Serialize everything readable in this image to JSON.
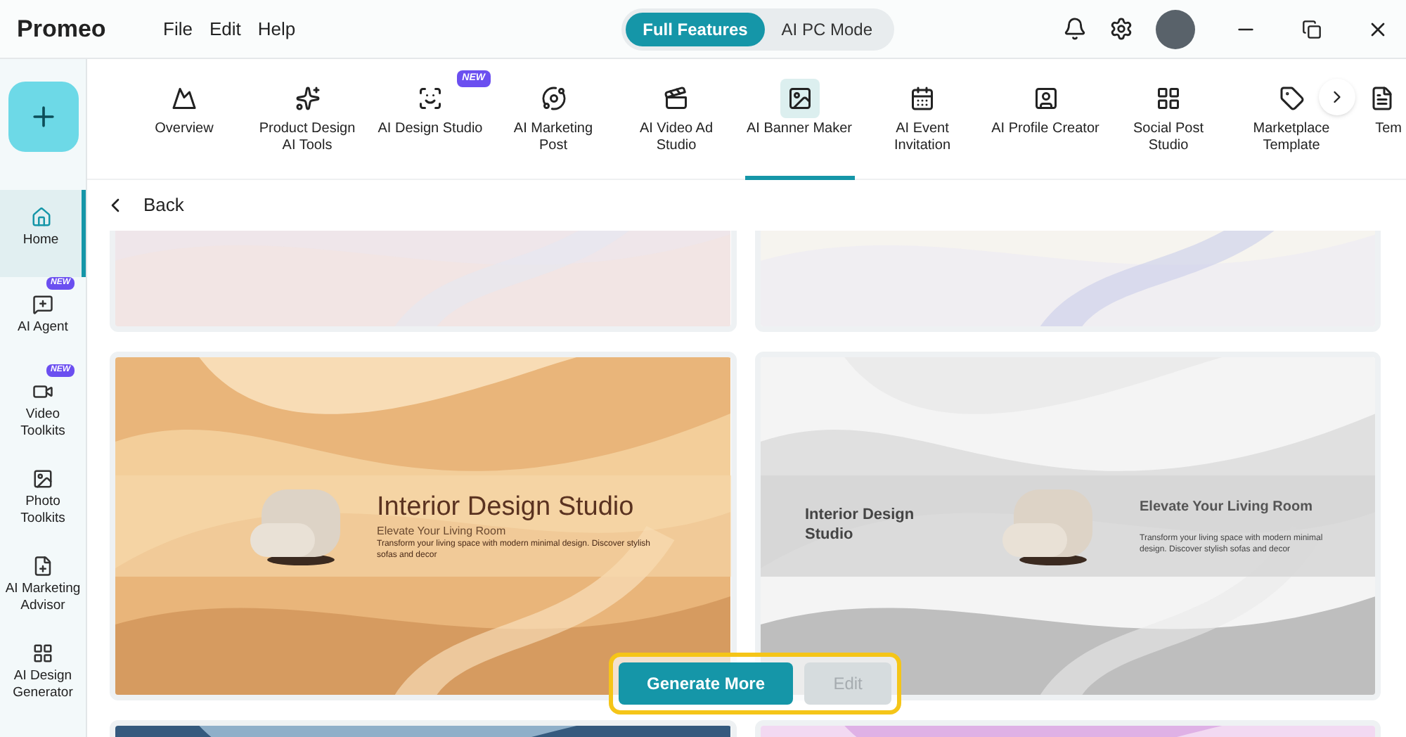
{
  "app": {
    "title": "Promeo"
  },
  "menu": [
    "File",
    "Edit",
    "Help"
  ],
  "modes": [
    {
      "label": "Full Features",
      "selected": true
    },
    {
      "label": "AI PC Mode",
      "selected": false
    }
  ],
  "tools": [
    {
      "label": "Overview",
      "selected": false
    },
    {
      "label": "Product Design AI Tools",
      "selected": false
    },
    {
      "label": "AI Design Studio",
      "selected": false,
      "badge": "NEW"
    },
    {
      "label": "AI Marketing Post",
      "selected": false
    },
    {
      "label": "AI Video Ad Studio",
      "selected": false
    },
    {
      "label": "AI Banner Maker",
      "selected": true
    },
    {
      "label": "AI Event Invitation",
      "selected": false
    },
    {
      "label": "AI Profile Creator",
      "selected": false
    },
    {
      "label": "Social Post Studio",
      "selected": false
    },
    {
      "label": "Marketplace Template",
      "selected": false
    },
    {
      "label": "Tem",
      "selected": false
    }
  ],
  "sidebar": [
    {
      "label": "Home",
      "selected": true
    },
    {
      "label": "AI Agent",
      "selected": false,
      "badge": "NEW"
    },
    {
      "label": "Video Toolkits",
      "selected": false,
      "badge": "NEW"
    },
    {
      "label": "Photo Toolkits",
      "selected": false
    },
    {
      "label": "AI Marketing Advisor",
      "selected": false
    },
    {
      "label": "AI Design Generator",
      "selected": false
    }
  ],
  "back": "Back",
  "banners": [
    {
      "kind": "picture"
    },
    {
      "kind": "picture"
    },
    {
      "kind": "banner",
      "title": "Interior Design Studio",
      "subtitle": "Elevate Your Living Room",
      "body": "Transform your living space with modern minimal design. Discover stylish sofas and decor"
    },
    {
      "kind": "banner",
      "title": "Interior Design Studio",
      "subtitle": "Elevate Your Living Room",
      "body": "Transform your living space with modern minimal design. Discover stylish sofas and decor"
    },
    {
      "kind": "picture"
    },
    {
      "kind": "picture"
    }
  ],
  "actions": [
    {
      "label": "Generate More",
      "disabled": false
    },
    {
      "label": "Edit",
      "disabled": true
    }
  ]
}
